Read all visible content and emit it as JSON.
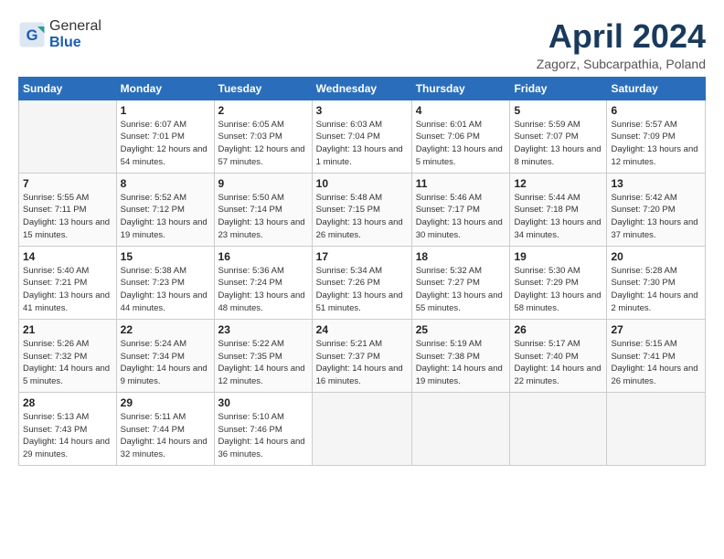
{
  "header": {
    "logo_general": "General",
    "logo_blue": "Blue",
    "title": "April 2024",
    "subtitle": "Zagorz, Subcarpathia, Poland"
  },
  "calendar": {
    "weekdays": [
      "Sunday",
      "Monday",
      "Tuesday",
      "Wednesday",
      "Thursday",
      "Friday",
      "Saturday"
    ],
    "weeks": [
      [
        {
          "day": "",
          "sunrise": "",
          "sunset": "",
          "daylight": ""
        },
        {
          "day": "1",
          "sunrise": "Sunrise: 6:07 AM",
          "sunset": "Sunset: 7:01 PM",
          "daylight": "Daylight: 12 hours and 54 minutes."
        },
        {
          "day": "2",
          "sunrise": "Sunrise: 6:05 AM",
          "sunset": "Sunset: 7:03 PM",
          "daylight": "Daylight: 12 hours and 57 minutes."
        },
        {
          "day": "3",
          "sunrise": "Sunrise: 6:03 AM",
          "sunset": "Sunset: 7:04 PM",
          "daylight": "Daylight: 13 hours and 1 minute."
        },
        {
          "day": "4",
          "sunrise": "Sunrise: 6:01 AM",
          "sunset": "Sunset: 7:06 PM",
          "daylight": "Daylight: 13 hours and 5 minutes."
        },
        {
          "day": "5",
          "sunrise": "Sunrise: 5:59 AM",
          "sunset": "Sunset: 7:07 PM",
          "daylight": "Daylight: 13 hours and 8 minutes."
        },
        {
          "day": "6",
          "sunrise": "Sunrise: 5:57 AM",
          "sunset": "Sunset: 7:09 PM",
          "daylight": "Daylight: 13 hours and 12 minutes."
        }
      ],
      [
        {
          "day": "7",
          "sunrise": "Sunrise: 5:55 AM",
          "sunset": "Sunset: 7:11 PM",
          "daylight": "Daylight: 13 hours and 15 minutes."
        },
        {
          "day": "8",
          "sunrise": "Sunrise: 5:52 AM",
          "sunset": "Sunset: 7:12 PM",
          "daylight": "Daylight: 13 hours and 19 minutes."
        },
        {
          "day": "9",
          "sunrise": "Sunrise: 5:50 AM",
          "sunset": "Sunset: 7:14 PM",
          "daylight": "Daylight: 13 hours and 23 minutes."
        },
        {
          "day": "10",
          "sunrise": "Sunrise: 5:48 AM",
          "sunset": "Sunset: 7:15 PM",
          "daylight": "Daylight: 13 hours and 26 minutes."
        },
        {
          "day": "11",
          "sunrise": "Sunrise: 5:46 AM",
          "sunset": "Sunset: 7:17 PM",
          "daylight": "Daylight: 13 hours and 30 minutes."
        },
        {
          "day": "12",
          "sunrise": "Sunrise: 5:44 AM",
          "sunset": "Sunset: 7:18 PM",
          "daylight": "Daylight: 13 hours and 34 minutes."
        },
        {
          "day": "13",
          "sunrise": "Sunrise: 5:42 AM",
          "sunset": "Sunset: 7:20 PM",
          "daylight": "Daylight: 13 hours and 37 minutes."
        }
      ],
      [
        {
          "day": "14",
          "sunrise": "Sunrise: 5:40 AM",
          "sunset": "Sunset: 7:21 PM",
          "daylight": "Daylight: 13 hours and 41 minutes."
        },
        {
          "day": "15",
          "sunrise": "Sunrise: 5:38 AM",
          "sunset": "Sunset: 7:23 PM",
          "daylight": "Daylight: 13 hours and 44 minutes."
        },
        {
          "day": "16",
          "sunrise": "Sunrise: 5:36 AM",
          "sunset": "Sunset: 7:24 PM",
          "daylight": "Daylight: 13 hours and 48 minutes."
        },
        {
          "day": "17",
          "sunrise": "Sunrise: 5:34 AM",
          "sunset": "Sunset: 7:26 PM",
          "daylight": "Daylight: 13 hours and 51 minutes."
        },
        {
          "day": "18",
          "sunrise": "Sunrise: 5:32 AM",
          "sunset": "Sunset: 7:27 PM",
          "daylight": "Daylight: 13 hours and 55 minutes."
        },
        {
          "day": "19",
          "sunrise": "Sunrise: 5:30 AM",
          "sunset": "Sunset: 7:29 PM",
          "daylight": "Daylight: 13 hours and 58 minutes."
        },
        {
          "day": "20",
          "sunrise": "Sunrise: 5:28 AM",
          "sunset": "Sunset: 7:30 PM",
          "daylight": "Daylight: 14 hours and 2 minutes."
        }
      ],
      [
        {
          "day": "21",
          "sunrise": "Sunrise: 5:26 AM",
          "sunset": "Sunset: 7:32 PM",
          "daylight": "Daylight: 14 hours and 5 minutes."
        },
        {
          "day": "22",
          "sunrise": "Sunrise: 5:24 AM",
          "sunset": "Sunset: 7:34 PM",
          "daylight": "Daylight: 14 hours and 9 minutes."
        },
        {
          "day": "23",
          "sunrise": "Sunrise: 5:22 AM",
          "sunset": "Sunset: 7:35 PM",
          "daylight": "Daylight: 14 hours and 12 minutes."
        },
        {
          "day": "24",
          "sunrise": "Sunrise: 5:21 AM",
          "sunset": "Sunset: 7:37 PM",
          "daylight": "Daylight: 14 hours and 16 minutes."
        },
        {
          "day": "25",
          "sunrise": "Sunrise: 5:19 AM",
          "sunset": "Sunset: 7:38 PM",
          "daylight": "Daylight: 14 hours and 19 minutes."
        },
        {
          "day": "26",
          "sunrise": "Sunrise: 5:17 AM",
          "sunset": "Sunset: 7:40 PM",
          "daylight": "Daylight: 14 hours and 22 minutes."
        },
        {
          "day": "27",
          "sunrise": "Sunrise: 5:15 AM",
          "sunset": "Sunset: 7:41 PM",
          "daylight": "Daylight: 14 hours and 26 minutes."
        }
      ],
      [
        {
          "day": "28",
          "sunrise": "Sunrise: 5:13 AM",
          "sunset": "Sunset: 7:43 PM",
          "daylight": "Daylight: 14 hours and 29 minutes."
        },
        {
          "day": "29",
          "sunrise": "Sunrise: 5:11 AM",
          "sunset": "Sunset: 7:44 PM",
          "daylight": "Daylight: 14 hours and 32 minutes."
        },
        {
          "day": "30",
          "sunrise": "Sunrise: 5:10 AM",
          "sunset": "Sunset: 7:46 PM",
          "daylight": "Daylight: 14 hours and 36 minutes."
        },
        {
          "day": "",
          "sunrise": "",
          "sunset": "",
          "daylight": ""
        },
        {
          "day": "",
          "sunrise": "",
          "sunset": "",
          "daylight": ""
        },
        {
          "day": "",
          "sunrise": "",
          "sunset": "",
          "daylight": ""
        },
        {
          "day": "",
          "sunrise": "",
          "sunset": "",
          "daylight": ""
        }
      ]
    ]
  }
}
